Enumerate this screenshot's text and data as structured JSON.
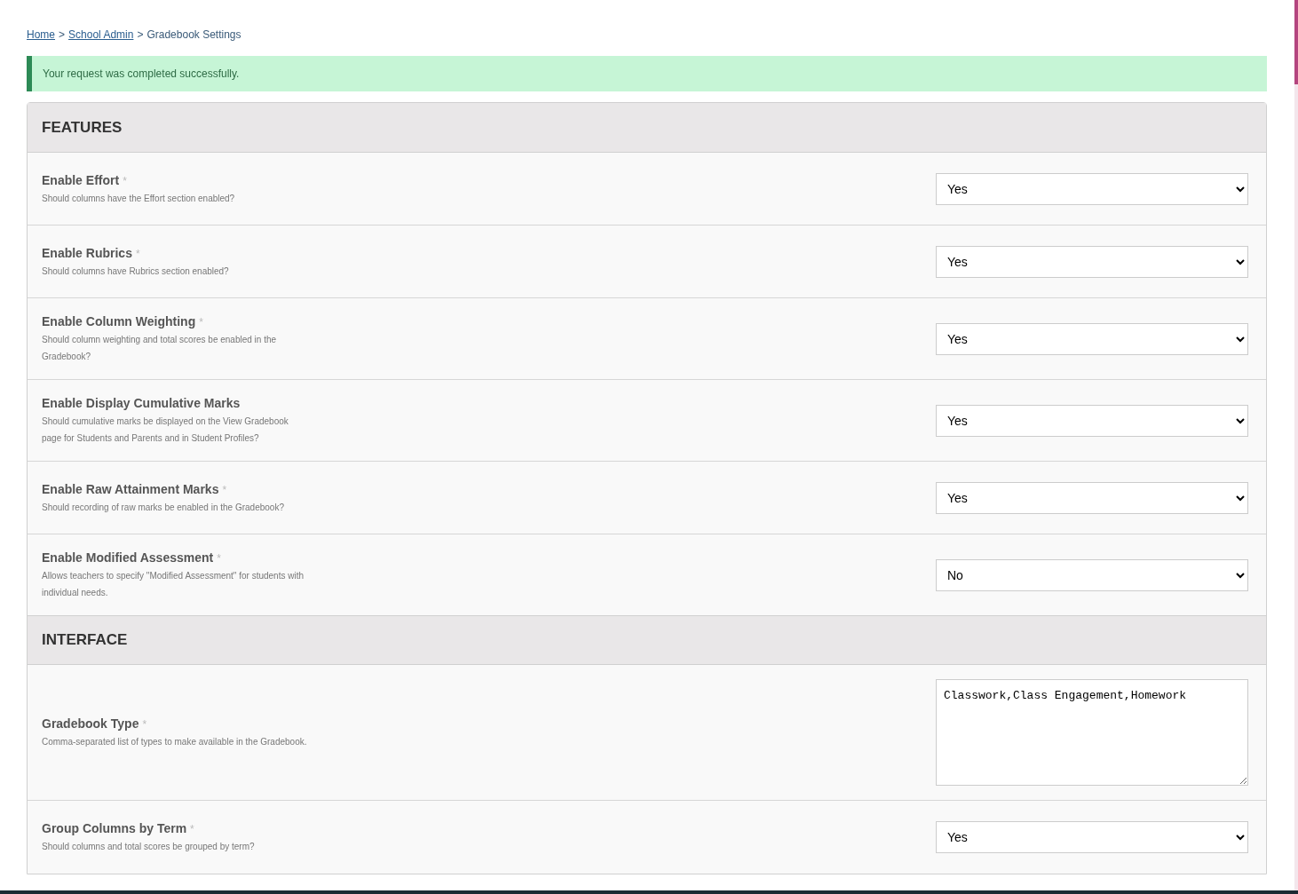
{
  "breadcrumb": {
    "links": [
      "Home",
      "School Admin"
    ],
    "separator": ">",
    "current": "Gradebook Settings"
  },
  "alert": {
    "message": "Your request was completed successfully."
  },
  "sections": [
    {
      "title": "FEATURES",
      "fields": [
        {
          "kind": "select",
          "label": "Enable Effort",
          "mark": "*",
          "description": "Should columns have the Effort section enabled?",
          "value": "Yes"
        },
        {
          "kind": "select",
          "label": "Enable Rubrics",
          "mark": "*",
          "description": "Should columns have Rubrics section enabled?",
          "value": "Yes"
        },
        {
          "kind": "select",
          "label": "Enable Column Weighting",
          "mark": "*",
          "description": "Should column weighting and total scores be enabled in the Gradebook?",
          "value": "Yes"
        },
        {
          "kind": "select",
          "label": "Enable Display Cumulative Marks",
          "description": "Should cumulative marks be displayed on the View Gradebook page for Students and Parents and in Student Profiles?",
          "value": "Yes"
        },
        {
          "kind": "select",
          "label": "Enable Raw Attainment Marks",
          "mark": "*",
          "description": "Should recording of raw marks be enabled in the Gradebook?",
          "value": "Yes"
        },
        {
          "kind": "select",
          "label": "Enable Modified Assessment",
          "mark": "*",
          "description": "Allows teachers to specify \"Modified Assessment\" for students with individual needs.",
          "value": "No"
        }
      ]
    },
    {
      "title": "INTERFACE",
      "fields": [
        {
          "kind": "textarea",
          "label": "Gradebook Type",
          "mark": "*",
          "description": "Comma-separated list of types to make available in the Gradebook.",
          "value": "Classwork,Class Engagement,Homework"
        },
        {
          "kind": "select",
          "label": "Group Columns by Term",
          "mark": "*",
          "description": "Should columns and total scores be grouped by term?",
          "value": "Yes"
        }
      ]
    }
  ]
}
